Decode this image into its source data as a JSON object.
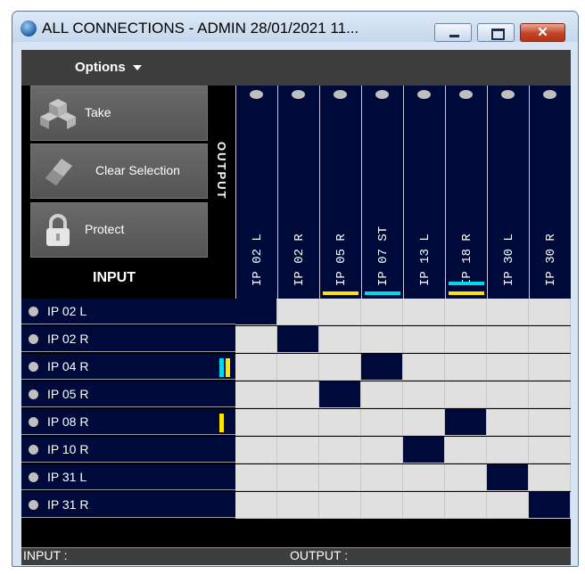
{
  "window": {
    "title": "ALL CONNECTIONS - ADMIN  28/01/2021 11...",
    "close_glyph": "✕"
  },
  "menu": {
    "options_label": "Options"
  },
  "controls": {
    "take_label": "Take",
    "clear_label": "Clear Selection",
    "protect_label": "Protect",
    "output_heading": "OUTPUT",
    "input_heading": "INPUT"
  },
  "columns": [
    {
      "label": "IP 02 L",
      "mark": null
    },
    {
      "label": "IP 02 R",
      "mark": null
    },
    {
      "label": "IP 05 R",
      "mark": "#ffe500"
    },
    {
      "label": "IP 07 ST",
      "mark": "#00d8f0"
    },
    {
      "label": "IP 13 L",
      "mark": null
    },
    {
      "label": "IP 18 R",
      "mark": "#ffe500",
      "mark2": "#00d8f0"
    },
    {
      "label": "IP 30 L",
      "mark": null
    },
    {
      "label": "IP 30 R",
      "mark": null
    }
  ],
  "rows": [
    {
      "label": "IP 02 L",
      "on_col": 0,
      "marks": []
    },
    {
      "label": "IP 02 R",
      "on_col": 1,
      "marks": []
    },
    {
      "label": "IP 04 R",
      "on_col": 3,
      "marks": [
        "#00d8f0",
        "#ffe500"
      ]
    },
    {
      "label": "IP 05 R",
      "on_col": 2,
      "marks": []
    },
    {
      "label": "IP 08 R",
      "on_col": 5,
      "marks": [
        "#ffe500"
      ]
    },
    {
      "label": "IP 10 R",
      "on_col": 4,
      "marks": []
    },
    {
      "label": "IP 31 L",
      "on_col": 6,
      "marks": []
    },
    {
      "label": "IP 31 R",
      "on_col": 7,
      "marks": []
    }
  ],
  "status": {
    "input_label": "INPUT :",
    "output_label": "OUTPUT :"
  },
  "colors": {
    "matrix_dark": "#000a3a",
    "cell_empty": "#e0e0e0",
    "accent_yellow": "#ffe500",
    "accent_cyan": "#00d8f0"
  },
  "icons": [
    "globe-icon",
    "cubes-icon",
    "eraser-icon",
    "padlock-icon",
    "chevron-down-icon"
  ]
}
